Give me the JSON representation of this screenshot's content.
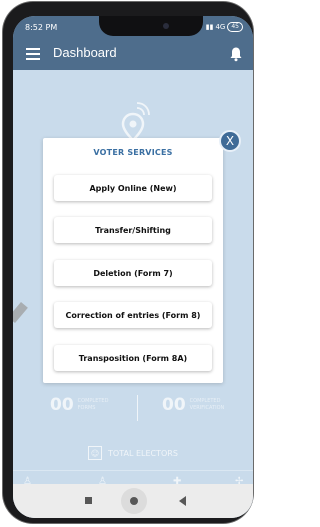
{
  "status_bar": {
    "time": "8:52 PM",
    "signal_text": "4G",
    "battery": "45"
  },
  "header": {
    "title": "Dashboard",
    "menu_icon": "hamburger-menu-icon",
    "bell_icon": "bell-icon"
  },
  "background": {
    "stats": [
      {
        "value": "00",
        "label_line1": "COMPLETED",
        "label_line2": "FORMS"
      },
      {
        "value": "00",
        "label_line1": "COMPLETED",
        "label_line2": "VERIFICATION"
      }
    ],
    "total_electors_label": "TOTAL ELECTORS"
  },
  "modal": {
    "title": "VOTER SERVICES",
    "buttons": [
      "Apply Online (New)",
      "Transfer/Shifting",
      "Deletion (Form 7)",
      "Correction of entries (Form 8)",
      "Transposition (Form 8A)"
    ],
    "close_label": "X"
  },
  "colors": {
    "header_bg": "#4e6d8c",
    "page_bg": "#b9d0e6",
    "modal_title": "#3a6fa2",
    "close_button": "#3f6b97"
  }
}
